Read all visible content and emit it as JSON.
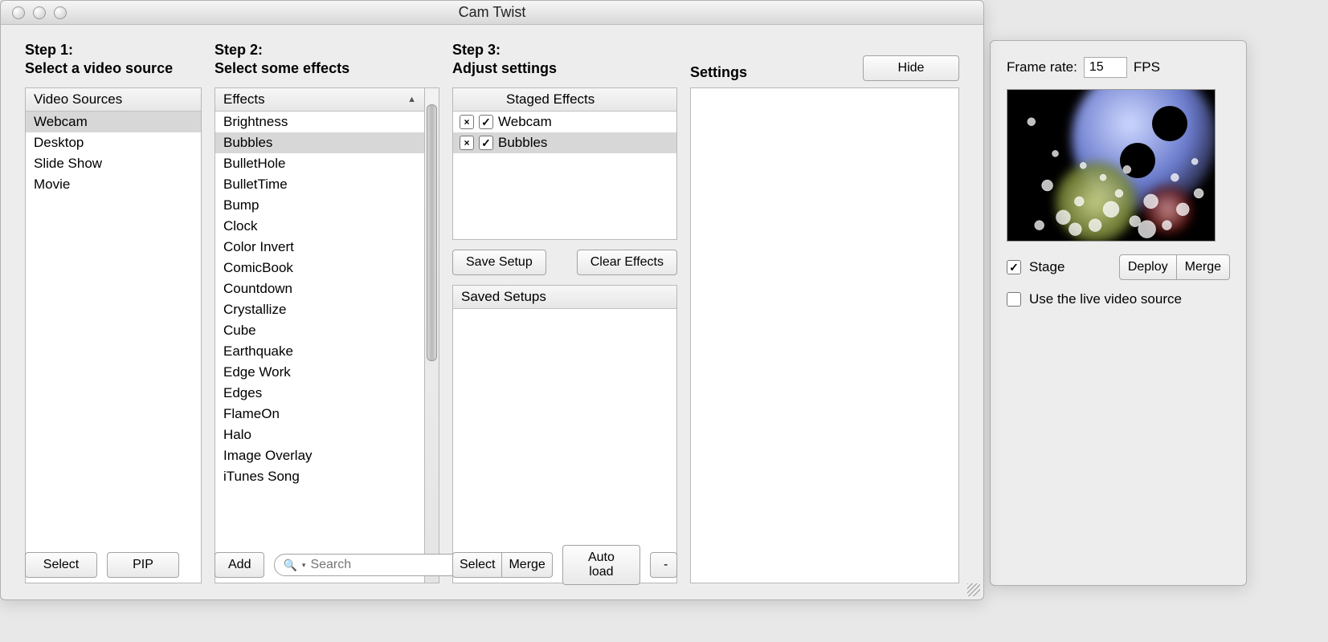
{
  "window": {
    "title": "Cam Twist"
  },
  "step1": {
    "heading_line1": "Step 1:",
    "heading_line2": "Select a video source",
    "header": "Video Sources",
    "items": [
      {
        "label": "Webcam",
        "selected": true
      },
      {
        "label": "Desktop",
        "selected": false
      },
      {
        "label": "Slide Show",
        "selected": false
      },
      {
        "label": "Movie",
        "selected": false
      }
    ],
    "select_btn": "Select",
    "pip_btn": "PIP"
  },
  "step2": {
    "heading_line1": "Step 2:",
    "heading_line2": "Select some effects",
    "header": "Effects",
    "sort_indicator": "▲",
    "items": [
      {
        "label": "Brightness",
        "selected": false
      },
      {
        "label": "Bubbles",
        "selected": true
      },
      {
        "label": "BulletHole",
        "selected": false
      },
      {
        "label": "BulletTime",
        "selected": false
      },
      {
        "label": "Bump",
        "selected": false
      },
      {
        "label": "Clock",
        "selected": false
      },
      {
        "label": "Color Invert",
        "selected": false
      },
      {
        "label": "ComicBook",
        "selected": false
      },
      {
        "label": "Countdown",
        "selected": false
      },
      {
        "label": "Crystallize",
        "selected": false
      },
      {
        "label": "Cube",
        "selected": false
      },
      {
        "label": "Earthquake",
        "selected": false
      },
      {
        "label": "Edge Work",
        "selected": false
      },
      {
        "label": "Edges",
        "selected": false
      },
      {
        "label": "FlameOn",
        "selected": false
      },
      {
        "label": "Halo",
        "selected": false
      },
      {
        "label": "Image Overlay",
        "selected": false
      },
      {
        "label": "iTunes Song",
        "selected": false
      }
    ],
    "add_btn": "Add",
    "search_placeholder": "Search"
  },
  "step3": {
    "heading_line1": "Step 3:",
    "heading_line2": "Adjust settings",
    "staged_header": "Staged Effects",
    "staged": [
      {
        "label": "Webcam",
        "enabled": true,
        "selected": false
      },
      {
        "label": "Bubbles",
        "enabled": true,
        "selected": true
      }
    ],
    "save_setup_btn": "Save Setup",
    "clear_effects_btn": "Clear Effects",
    "saved_header": "Saved Setups",
    "select_btn": "Select",
    "merge_btn": "Merge",
    "autoload_btn": "Auto load",
    "remove_btn": "-"
  },
  "settings": {
    "heading": "Settings",
    "hide_btn": "Hide"
  },
  "side": {
    "frame_rate_label": "Frame rate:",
    "frame_rate_value": "15",
    "fps_label": "FPS",
    "stage_checkbox_label": "Stage",
    "stage_checked": true,
    "deploy_btn": "Deploy",
    "merge_btn": "Merge",
    "live_checkbox_label": "Use the live video source",
    "live_checked": false
  }
}
